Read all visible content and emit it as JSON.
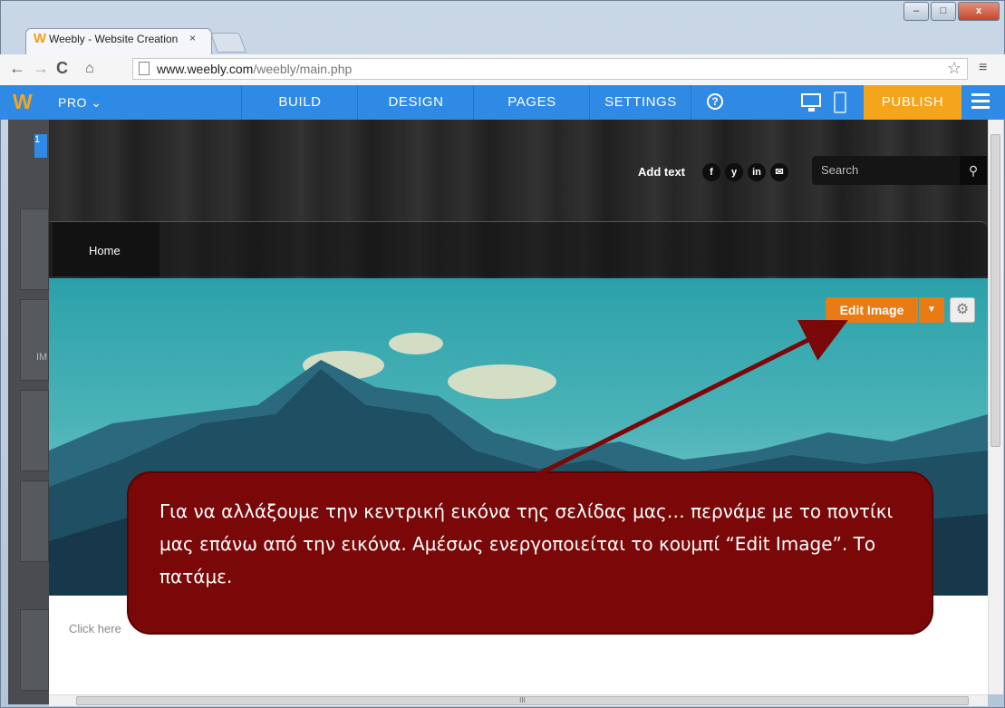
{
  "browser": {
    "tab_title": "Weebly - Website Creation",
    "tab_close": "×",
    "url_host": "www.weebly.com",
    "url_path": "/weebly/main.php",
    "window_buttons": [
      "–",
      "□",
      "x"
    ]
  },
  "weebly_bar": {
    "logo": "W",
    "plan": "PRO ⌄",
    "tabs": [
      "BUILD",
      "DESIGN",
      "PAGES",
      "SETTINGS"
    ],
    "help": "?",
    "publish": "PUBLISH",
    "accent": "#2f8ae5",
    "publish_color": "#f4a51c"
  },
  "left_panel": {
    "label": "IM",
    "top_badge": "1"
  },
  "site": {
    "add_text": "Add text",
    "social": [
      "f",
      "y",
      "in",
      "✉"
    ],
    "search_placeholder": "Search",
    "nav_home": "Home",
    "edit_image": "Edit Image",
    "click_here": "Click here"
  },
  "callout": {
    "text": "Για να αλλάξουμε την κεντρική εικόνα της σελίδας μας… περνάμε με το ποντίκι μας επάνω  από την εικόνα. Αμέσως ενεργοποιείται το κουμπί “Edit Image”. Το πατάμε.",
    "color": "#7a0808"
  },
  "scrollbar_mark": "III"
}
